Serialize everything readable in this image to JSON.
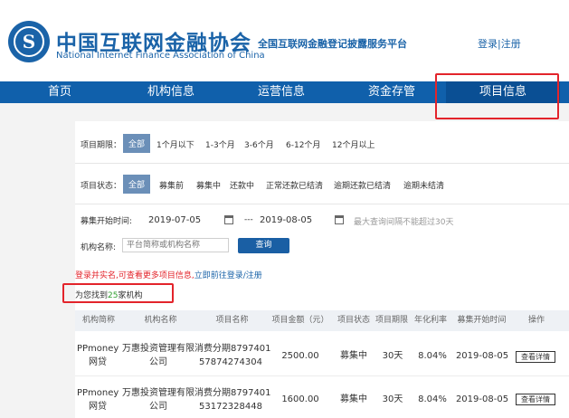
{
  "header": {
    "org_cn": "中国互联网金融协会",
    "org_en": "National Internet Finance Association of China",
    "platform": "全国互联网金融登记披露服务平台",
    "login": "登录",
    "separator": "|",
    "register": "注册"
  },
  "nav": {
    "items": [
      "首页",
      "机构信息",
      "运营信息",
      "资金存管",
      "项目信息"
    ],
    "active_index": 4
  },
  "filters": {
    "period_label": "项目期限：",
    "period_options": [
      "全部",
      "1个月以下",
      "1-3个月",
      "3-6个月",
      "6-12个月",
      "12个月以上"
    ],
    "status_label": "项目状态：",
    "status_options": [
      "全部",
      "募集前",
      "募集中",
      "还款中",
      "正常还款已结清",
      "逾期还款已结清",
      "逾期未结清"
    ],
    "date_label": "募集开始时间:",
    "date_start": "2019-07-05",
    "date_sep": "---",
    "date_end": "2019-08-05",
    "date_note": "最大查询间隔不能超过30天",
    "org_label": "机构名称:",
    "org_placeholder": "平台简称或机构名称",
    "query_button": "查询"
  },
  "tips": {
    "login_red": "登录并实名,可查看更多项目信息,",
    "login_blue": "立即前往登录/注册",
    "found_prefix": "为您找到",
    "found_count": "25",
    "found_suffix": "家机构"
  },
  "table": {
    "headers": [
      "机构简称",
      "机构名称",
      "项目名称",
      "项目金额（元）",
      "项目状态",
      "项目期限",
      "年化利率",
      "募集开始时间",
      "操作"
    ],
    "rows": [
      {
        "short_name_1": "PPmoney",
        "short_name_2": "网贷",
        "org_name_1": "万惠投资管理有限",
        "org_name_2": "公司",
        "project_1": "消费分期8797401",
        "project_2": "57874274304",
        "amount": "2500.00",
        "status": "募集中",
        "term": "30天",
        "rate": "8.04%",
        "start_date": "2019-08-05",
        "action": "查看详情"
      },
      {
        "short_name_1": "PPmoney",
        "short_name_2": "网贷",
        "org_name_1": "万惠投资管理有限",
        "org_name_2": "公司",
        "project_1": "消费分期8797401",
        "project_2": "53172328448",
        "amount": "1600.00",
        "status": "募集中",
        "term": "30天",
        "rate": "8.04%",
        "start_date": "2019-08-05",
        "action": "查看详情"
      }
    ]
  },
  "colors": {
    "brand_blue": "#1a63a8",
    "nav_blue": "#1060ab",
    "highlight_red": "#e3242b",
    "count_green": "#2e9e2e"
  }
}
